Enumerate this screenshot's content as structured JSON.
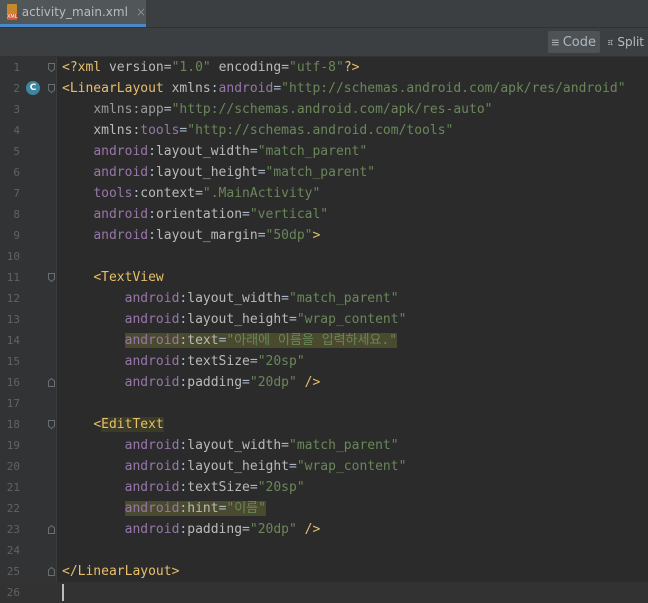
{
  "tab": {
    "filename": "activity_main.xml",
    "close": "×",
    "icon_text": "XML"
  },
  "toolbar": {
    "code_label": "Code",
    "split_label": "Split"
  },
  "gutter": {
    "badge": "C"
  },
  "lines": [
    {
      "n": "1",
      "tokens": [
        [
          "t-punct",
          "<?xml "
        ],
        [
          "t-attr",
          "version"
        ],
        [
          "t-plain",
          "="
        ],
        [
          "t-val",
          "\"1.0\""
        ],
        [
          "t-plain",
          " "
        ],
        [
          "t-attr",
          "encoding"
        ],
        [
          "t-plain",
          "="
        ],
        [
          "t-val",
          "\"utf-8\""
        ],
        [
          "t-punct",
          "?>"
        ]
      ]
    },
    {
      "n": "2",
      "tokens": [
        [
          "t-punct",
          "<"
        ],
        [
          "t-tag",
          "LinearLayout"
        ],
        [
          "t-plain",
          " "
        ],
        [
          "t-attr",
          "xmlns"
        ],
        [
          "t-plain",
          ":"
        ],
        [
          "t-ns",
          "android"
        ],
        [
          "t-plain",
          "="
        ],
        [
          "t-val",
          "\"http://schemas.android.com/apk/res/android\""
        ]
      ]
    },
    {
      "n": "3",
      "tokens": [
        [
          "t-plain",
          "    "
        ],
        [
          "t-dim",
          "xmlns:app"
        ],
        [
          "t-plain",
          "="
        ],
        [
          "t-val",
          "\"http://schemas.android.com/apk/res-auto\""
        ]
      ]
    },
    {
      "n": "4",
      "tokens": [
        [
          "t-plain",
          "    "
        ],
        [
          "t-attr",
          "xmlns"
        ],
        [
          "t-plain",
          ":"
        ],
        [
          "t-ns",
          "tools"
        ],
        [
          "t-plain",
          "="
        ],
        [
          "t-val",
          "\"http://schemas.android.com/tools\""
        ]
      ]
    },
    {
      "n": "5",
      "tokens": [
        [
          "t-plain",
          "    "
        ],
        [
          "t-ns",
          "android"
        ],
        [
          "t-plain",
          ":"
        ],
        [
          "t-attr",
          "layout_width"
        ],
        [
          "t-plain",
          "="
        ],
        [
          "t-val",
          "\"match_parent\""
        ]
      ]
    },
    {
      "n": "6",
      "tokens": [
        [
          "t-plain",
          "    "
        ],
        [
          "t-ns",
          "android"
        ],
        [
          "t-plain",
          ":"
        ],
        [
          "t-attr",
          "layout_height"
        ],
        [
          "t-plain",
          "="
        ],
        [
          "t-val",
          "\"match_parent\""
        ]
      ]
    },
    {
      "n": "7",
      "tokens": [
        [
          "t-plain",
          "    "
        ],
        [
          "t-ns",
          "tools"
        ],
        [
          "t-plain",
          ":"
        ],
        [
          "t-attr",
          "context"
        ],
        [
          "t-plain",
          "="
        ],
        [
          "t-val",
          "\".MainActivity\""
        ]
      ]
    },
    {
      "n": "8",
      "tokens": [
        [
          "t-plain",
          "    "
        ],
        [
          "t-ns",
          "android"
        ],
        [
          "t-plain",
          ":"
        ],
        [
          "t-attr",
          "orientation"
        ],
        [
          "t-plain",
          "="
        ],
        [
          "t-val",
          "\"vertical\""
        ]
      ]
    },
    {
      "n": "9",
      "tokens": [
        [
          "t-plain",
          "    "
        ],
        [
          "t-ns",
          "android"
        ],
        [
          "t-plain",
          ":"
        ],
        [
          "t-attr",
          "layout_margin"
        ],
        [
          "t-plain",
          "="
        ],
        [
          "t-val",
          "\"50dp\""
        ],
        [
          "t-punct",
          ">"
        ]
      ]
    },
    {
      "n": "10",
      "tokens": []
    },
    {
      "n": "11",
      "tokens": [
        [
          "t-plain",
          "    "
        ],
        [
          "t-punct",
          "<"
        ],
        [
          "t-tag",
          "TextView"
        ]
      ]
    },
    {
      "n": "12",
      "tokens": [
        [
          "t-plain",
          "        "
        ],
        [
          "t-ns",
          "android"
        ],
        [
          "t-plain",
          ":"
        ],
        [
          "t-attr",
          "layout_width"
        ],
        [
          "t-plain",
          "="
        ],
        [
          "t-val",
          "\"match_parent\""
        ]
      ]
    },
    {
      "n": "13",
      "tokens": [
        [
          "t-plain",
          "        "
        ],
        [
          "t-ns",
          "android"
        ],
        [
          "t-plain",
          ":"
        ],
        [
          "t-attr",
          "layout_height"
        ],
        [
          "t-plain",
          "="
        ],
        [
          "t-val",
          "\"wrap_content\""
        ]
      ]
    },
    {
      "n": "14",
      "tokens": [
        [
          "t-plain",
          "        "
        ],
        [
          "t-ns hl",
          "android"
        ],
        [
          "t-plain hl",
          ":"
        ],
        [
          "t-attr hl",
          "text"
        ],
        [
          "t-plain hl",
          "="
        ],
        [
          "t-val hl",
          "\"아래에 이름을 입력하세요.\""
        ]
      ]
    },
    {
      "n": "15",
      "tokens": [
        [
          "t-plain",
          "        "
        ],
        [
          "t-ns",
          "android"
        ],
        [
          "t-plain",
          ":"
        ],
        [
          "t-attr",
          "textSize"
        ],
        [
          "t-plain",
          "="
        ],
        [
          "t-val",
          "\"20sp\""
        ]
      ]
    },
    {
      "n": "16",
      "tokens": [
        [
          "t-plain",
          "        "
        ],
        [
          "t-ns",
          "android"
        ],
        [
          "t-plain",
          ":"
        ],
        [
          "t-attr",
          "padding"
        ],
        [
          "t-plain",
          "="
        ],
        [
          "t-val",
          "\"20dp\""
        ],
        [
          "t-plain",
          " "
        ],
        [
          "t-punct",
          "/>"
        ]
      ]
    },
    {
      "n": "17",
      "tokens": []
    },
    {
      "n": "18",
      "tokens": [
        [
          "t-plain",
          "    "
        ],
        [
          "t-punct",
          "<"
        ],
        [
          "t-tag hl-tag",
          "EditText"
        ]
      ]
    },
    {
      "n": "19",
      "tokens": [
        [
          "t-plain",
          "        "
        ],
        [
          "t-ns",
          "android"
        ],
        [
          "t-plain",
          ":"
        ],
        [
          "t-attr",
          "layout_width"
        ],
        [
          "t-plain",
          "="
        ],
        [
          "t-val",
          "\"match_parent\""
        ]
      ]
    },
    {
      "n": "20",
      "tokens": [
        [
          "t-plain",
          "        "
        ],
        [
          "t-ns",
          "android"
        ],
        [
          "t-plain",
          ":"
        ],
        [
          "t-attr",
          "layout_height"
        ],
        [
          "t-plain",
          "="
        ],
        [
          "t-val",
          "\"wrap_content\""
        ]
      ]
    },
    {
      "n": "21",
      "tokens": [
        [
          "t-plain",
          "        "
        ],
        [
          "t-ns",
          "android"
        ],
        [
          "t-plain",
          ":"
        ],
        [
          "t-attr",
          "textSize"
        ],
        [
          "t-plain",
          "="
        ],
        [
          "t-val",
          "\"20sp\""
        ]
      ]
    },
    {
      "n": "22",
      "tokens": [
        [
          "t-plain",
          "        "
        ],
        [
          "t-ns hl",
          "android"
        ],
        [
          "t-plain hl",
          ":"
        ],
        [
          "t-attr hl",
          "hint"
        ],
        [
          "t-plain hl",
          "="
        ],
        [
          "t-val hl",
          "\"이름\""
        ]
      ]
    },
    {
      "n": "23",
      "tokens": [
        [
          "t-plain",
          "        "
        ],
        [
          "t-ns",
          "android"
        ],
        [
          "t-plain",
          ":"
        ],
        [
          "t-attr",
          "padding"
        ],
        [
          "t-plain",
          "="
        ],
        [
          "t-val",
          "\"20dp\""
        ],
        [
          "t-plain",
          " "
        ],
        [
          "t-punct",
          "/>"
        ]
      ]
    },
    {
      "n": "24",
      "tokens": []
    },
    {
      "n": "25",
      "tokens": [
        [
          "t-punct",
          "</"
        ],
        [
          "t-tag",
          "LinearLayout"
        ],
        [
          "t-punct",
          ">"
        ]
      ]
    },
    {
      "n": "26",
      "tokens": []
    }
  ],
  "colors": {
    "background": "#2b2b2b",
    "tag": "#e8bf6a",
    "namespace": "#9876aa",
    "attribute": "#bababa",
    "string": "#6a8759",
    "line_number": "#606366",
    "tab_underline": "#4a88c7"
  },
  "icons": [
    "xml-file-icon",
    "close-icon",
    "code-view-icon",
    "split-view-icon",
    "class-badge-icon",
    "fold-icon"
  ]
}
